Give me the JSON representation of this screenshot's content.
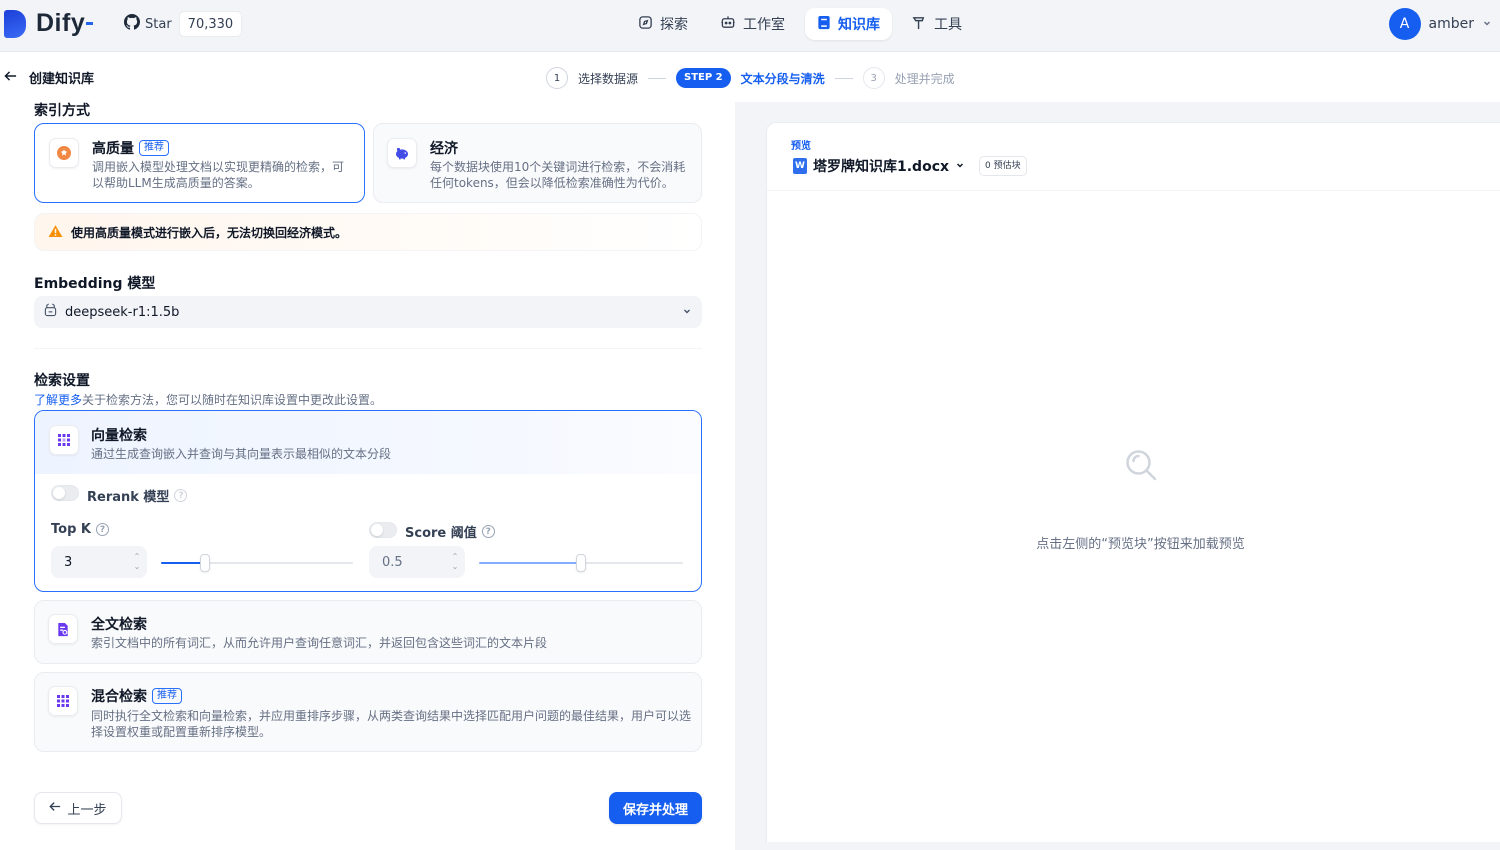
{
  "brand": {
    "name": "Dify"
  },
  "github": {
    "star_label": "Star",
    "star_count": "70,330"
  },
  "nav": [
    {
      "label": "探索",
      "icon": "compass-icon"
    },
    {
      "label": "工作室",
      "icon": "robot-icon"
    },
    {
      "label": "知识库",
      "icon": "book-icon",
      "active": true
    },
    {
      "label": "工具",
      "icon": "hammer-icon"
    }
  ],
  "user": {
    "initial": "A",
    "name": "amber"
  },
  "page": {
    "title": "创建知识库"
  },
  "steps": [
    {
      "number": "1",
      "label": "选择数据源"
    },
    {
      "pill": "STEP 2",
      "label": "文本分段与清洗"
    },
    {
      "number": "3",
      "label": "处理并完成"
    }
  ],
  "index": {
    "section_title": "索引方式",
    "high_quality": {
      "title": "高质量",
      "badge": "推荐",
      "desc": "调用嵌入模型处理文档以实现更精确的检索，可以帮助LLM生成高质量的答案。"
    },
    "economy": {
      "title": "经济",
      "desc": "每个数据块使用10个关键词进行检索，不会消耗任何tokens，但会以降低检索准确性为代价。"
    },
    "warning": "使用高质量模式进行嵌入后，无法切换回经济模式。"
  },
  "embedding": {
    "title": "Embedding 模型",
    "value": "deepseek-r1:1.5b"
  },
  "retrieval": {
    "title": "检索设置",
    "learn_more": "了解更多",
    "desc": "关于检索方法，您可以随时在知识库设置中更改此设置。",
    "vector": {
      "title": "向量检索",
      "desc": "通过生成查询嵌入并查询与其向量表示最相似的文本分段"
    },
    "rerank_label": "Rerank 模型",
    "rerank_enabled": false,
    "topk": {
      "label": "Top K",
      "value": "3",
      "slider_fraction": 0.23
    },
    "score": {
      "label": "Score 阈值",
      "value": "0.5",
      "enabled": false,
      "slider_fraction": 0.5
    },
    "fulltext": {
      "title": "全文检索",
      "desc": "索引文档中的所有词汇，从而允许用户查询任意词汇，并返回包含这些词汇的文本片段"
    },
    "hybrid": {
      "title": "混合检索",
      "badge": "推荐",
      "desc": "同时执行全文检索和向量检索，并应用重排序步骤，从两类查询结果中选择匹配用户问题的最佳结果，用户可以选择设置权重或配置重新排序模型。"
    }
  },
  "actions": {
    "back": "上一步",
    "save": "保存并处理"
  },
  "preview": {
    "label": "预览",
    "file_name": "塔罗牌知识库1.docx",
    "chunk_badge": "0 预估块",
    "empty_text": "点击左侧的“预览块”按钮来加载预览"
  },
  "colors": {
    "primary": "#155eef",
    "warning": "#f79009"
  }
}
